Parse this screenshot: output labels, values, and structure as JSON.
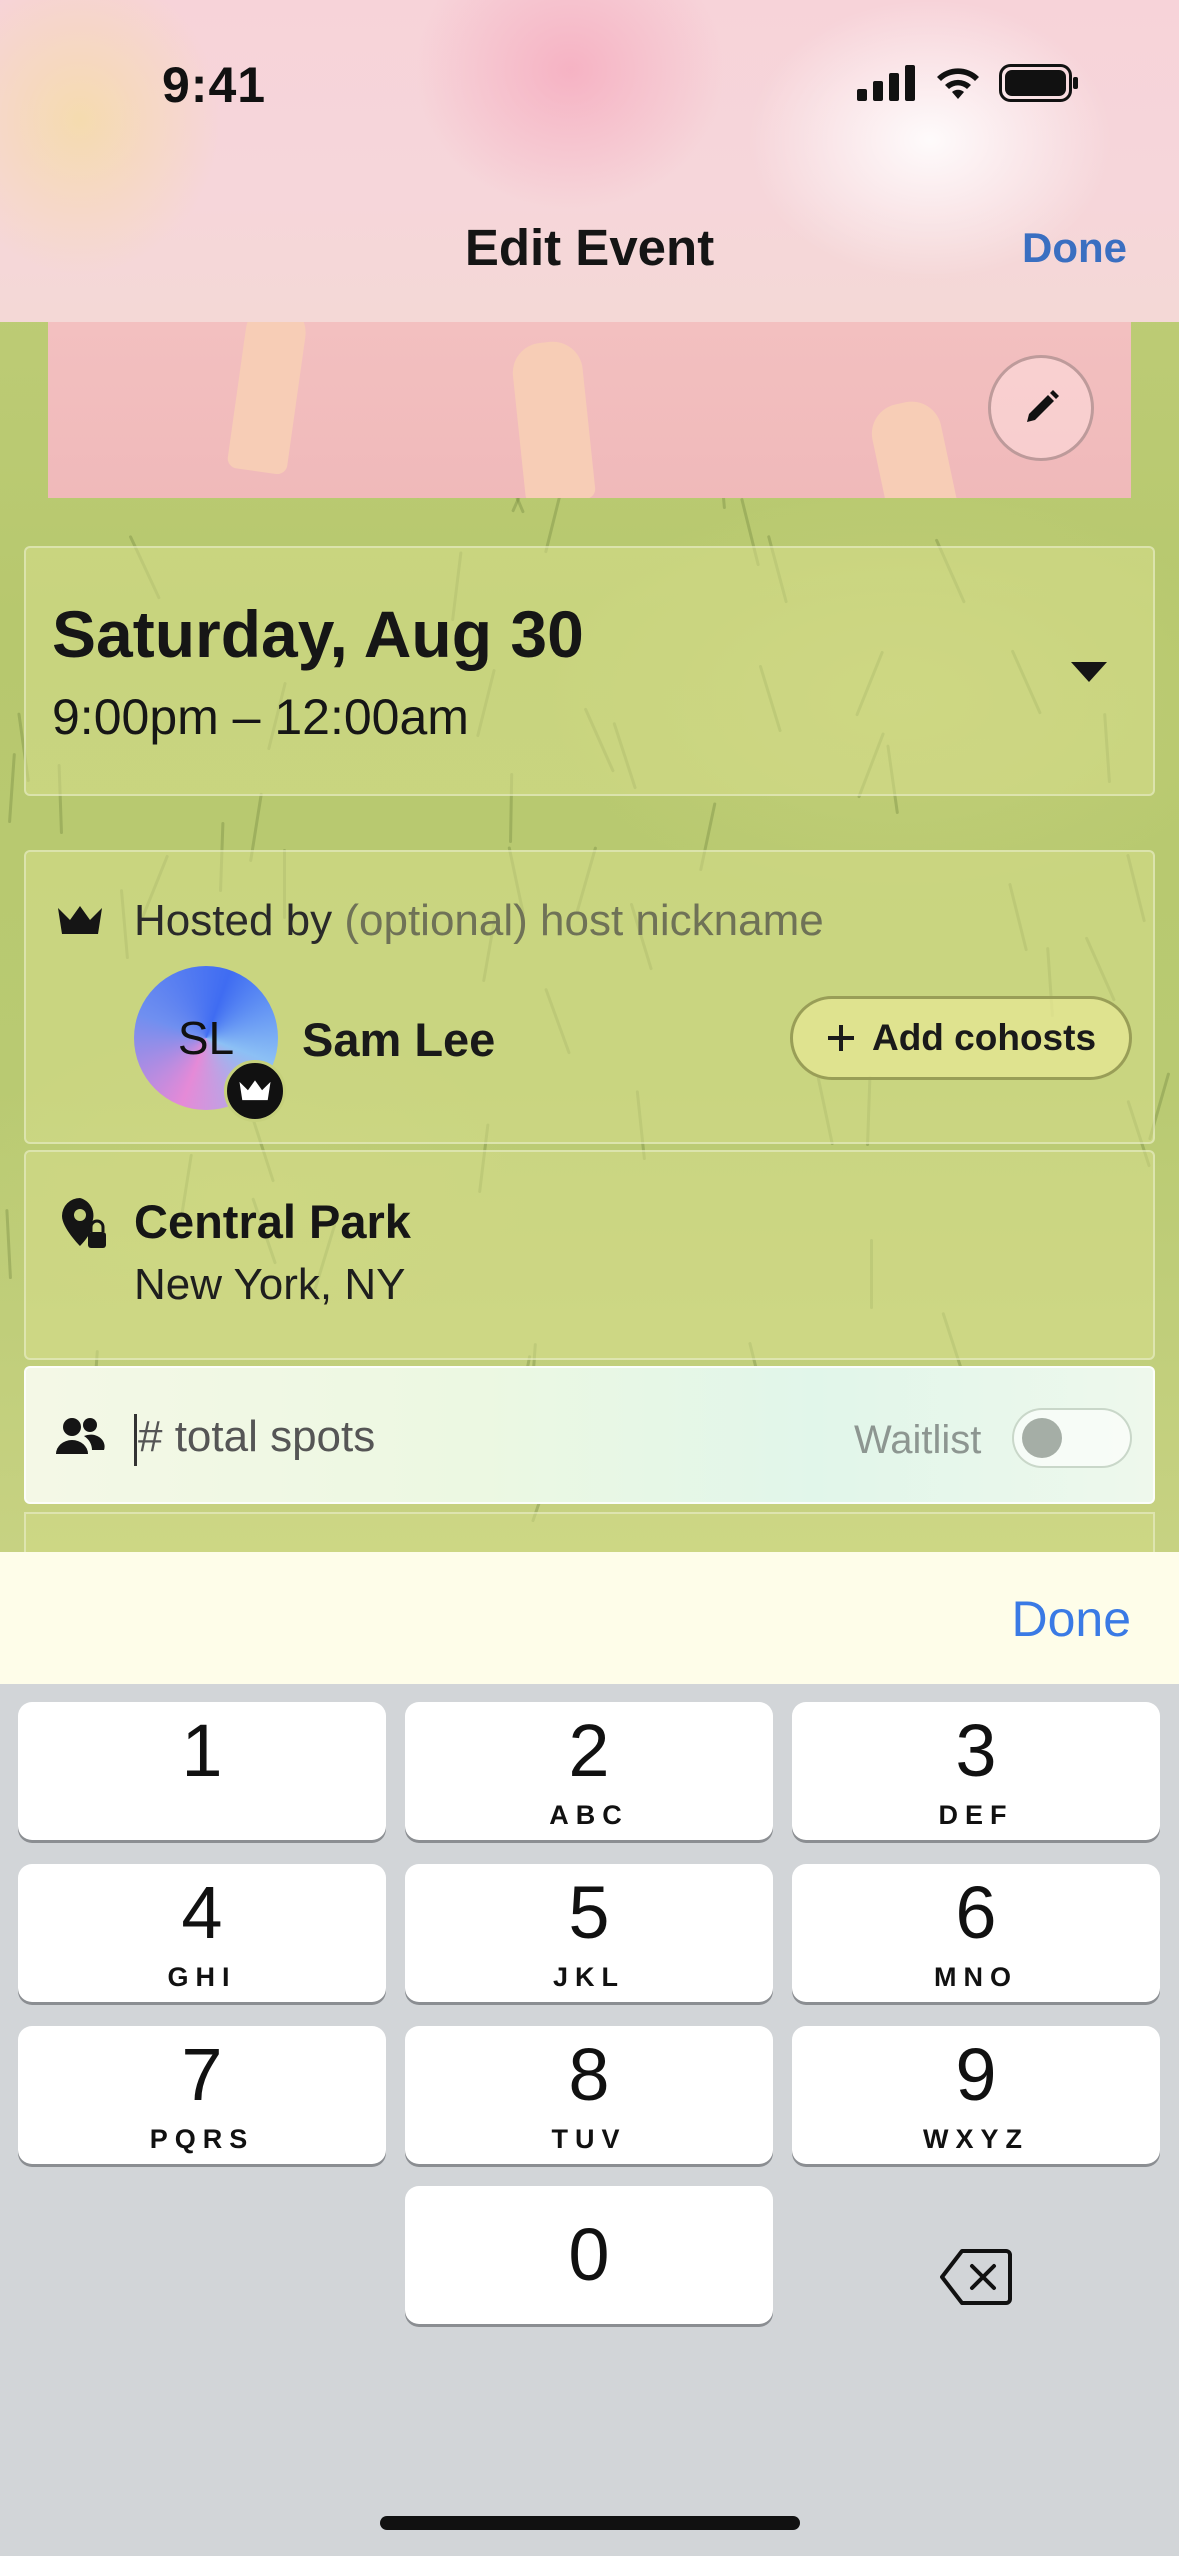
{
  "status_bar": {
    "time": "9:41"
  },
  "nav": {
    "title": "Edit Event",
    "done_label": "Done"
  },
  "event": {
    "date": "Saturday, Aug 30",
    "time_range": "9:00pm – 12:00am"
  },
  "host": {
    "hosted_by_label": "Hosted by",
    "nickname_placeholder": "(optional) host nickname",
    "initials": "SL",
    "name": "Sam Lee",
    "add_cohosts_label": "Add cohosts"
  },
  "location": {
    "name": "Central Park",
    "city": "New York, NY"
  },
  "capacity": {
    "input_placeholder": "# total spots",
    "waitlist_label": "Waitlist",
    "waitlist_enabled": false
  },
  "keyboard": {
    "done_label": "Done",
    "keys": [
      {
        "num": "1",
        "letters": ""
      },
      {
        "num": "2",
        "letters": "ABC"
      },
      {
        "num": "3",
        "letters": "DEF"
      },
      {
        "num": "4",
        "letters": "GHI"
      },
      {
        "num": "5",
        "letters": "JKL"
      },
      {
        "num": "6",
        "letters": "MNO"
      },
      {
        "num": "7",
        "letters": "PQRS"
      },
      {
        "num": "8",
        "letters": "TUV"
      },
      {
        "num": "9",
        "letters": "WXYZ"
      },
      {
        "num": "0",
        "letters": ""
      }
    ]
  },
  "colors": {
    "accent": "#3a6fc1",
    "keyboard_done": "#3a7ae5",
    "keyboard_bg": "#d2d5d8"
  }
}
